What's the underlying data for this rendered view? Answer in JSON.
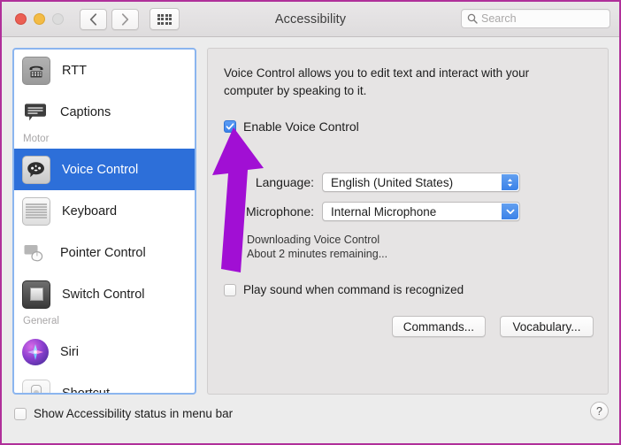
{
  "window": {
    "title": "Accessibility",
    "traffic_lights": [
      "close-red",
      "minimize-yellow",
      "zoom-disabled"
    ],
    "nav_back_icon": "chevron-left-icon",
    "nav_forward_icon": "chevron-right-icon",
    "grid_icon": "show-all-grid-icon",
    "accent_blue": "#2d6fd9",
    "annotation_color": "#a10fd4"
  },
  "search": {
    "placeholder": "Search",
    "value": "",
    "icon": "search-icon"
  },
  "sidebar": {
    "items": [
      {
        "type": "item",
        "label": "RTT",
        "icon": "rtt-icon",
        "selected": false
      },
      {
        "type": "item",
        "label": "Captions",
        "icon": "captions-icon",
        "selected": false
      },
      {
        "type": "group",
        "label": "Motor"
      },
      {
        "type": "item",
        "label": "Voice Control",
        "icon": "voice-control-icon",
        "selected": true
      },
      {
        "type": "item",
        "label": "Keyboard",
        "icon": "keyboard-icon",
        "selected": false
      },
      {
        "type": "item",
        "label": "Pointer Control",
        "icon": "pointer-control-icon",
        "selected": false
      },
      {
        "type": "item",
        "label": "Switch Control",
        "icon": "switch-control-icon",
        "selected": false
      },
      {
        "type": "group",
        "label": "General"
      },
      {
        "type": "item",
        "label": "Siri",
        "icon": "siri-icon",
        "selected": false
      },
      {
        "type": "item",
        "label": "Shortcut",
        "icon": "shortcut-icon",
        "selected": false
      }
    ]
  },
  "panel": {
    "description": "Voice Control allows you to edit text and interact with your computer by speaking to it.",
    "enable_checkbox": {
      "label": "Enable Voice Control",
      "checked": true
    },
    "language_row": {
      "label": "Language:",
      "value": "English (United States)",
      "chevron": "chevron-up-down-icon"
    },
    "microphone_row": {
      "label": "Microphone:",
      "value": "Internal Microphone",
      "chevron": "chevron-down-icon"
    },
    "download": {
      "icon": "progress-spinner-icon",
      "title": "Downloading Voice Control",
      "subtitle": "About 2 minutes remaining..."
    },
    "play_sound_checkbox": {
      "label": "Play sound when command is recognized",
      "checked": false
    },
    "commands_button": "Commands...",
    "vocabulary_button": "Vocabulary..."
  },
  "footer": {
    "status_checkbox": {
      "label": "Show Accessibility status in menu bar",
      "checked": false
    },
    "help_button": "?"
  }
}
